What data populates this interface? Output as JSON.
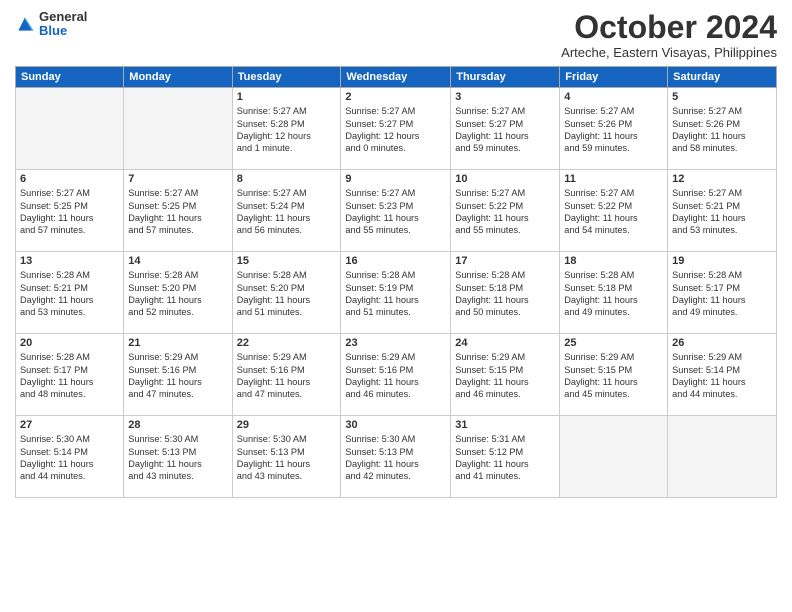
{
  "logo": {
    "general": "General",
    "blue": "Blue"
  },
  "title": "October 2024",
  "subtitle": "Arteche, Eastern Visayas, Philippines",
  "days_of_week": [
    "Sunday",
    "Monday",
    "Tuesday",
    "Wednesday",
    "Thursday",
    "Friday",
    "Saturday"
  ],
  "weeks": [
    [
      {
        "day": "",
        "info": ""
      },
      {
        "day": "",
        "info": ""
      },
      {
        "day": "1",
        "info": "Sunrise: 5:27 AM\nSunset: 5:28 PM\nDaylight: 12 hours\nand 1 minute."
      },
      {
        "day": "2",
        "info": "Sunrise: 5:27 AM\nSunset: 5:27 PM\nDaylight: 12 hours\nand 0 minutes."
      },
      {
        "day": "3",
        "info": "Sunrise: 5:27 AM\nSunset: 5:27 PM\nDaylight: 11 hours\nand 59 minutes."
      },
      {
        "day": "4",
        "info": "Sunrise: 5:27 AM\nSunset: 5:26 PM\nDaylight: 11 hours\nand 59 minutes."
      },
      {
        "day": "5",
        "info": "Sunrise: 5:27 AM\nSunset: 5:26 PM\nDaylight: 11 hours\nand 58 minutes."
      }
    ],
    [
      {
        "day": "6",
        "info": "Sunrise: 5:27 AM\nSunset: 5:25 PM\nDaylight: 11 hours\nand 57 minutes."
      },
      {
        "day": "7",
        "info": "Sunrise: 5:27 AM\nSunset: 5:25 PM\nDaylight: 11 hours\nand 57 minutes."
      },
      {
        "day": "8",
        "info": "Sunrise: 5:27 AM\nSunset: 5:24 PM\nDaylight: 11 hours\nand 56 minutes."
      },
      {
        "day": "9",
        "info": "Sunrise: 5:27 AM\nSunset: 5:23 PM\nDaylight: 11 hours\nand 55 minutes."
      },
      {
        "day": "10",
        "info": "Sunrise: 5:27 AM\nSunset: 5:22 PM\nDaylight: 11 hours\nand 55 minutes."
      },
      {
        "day": "11",
        "info": "Sunrise: 5:27 AM\nSunset: 5:22 PM\nDaylight: 11 hours\nand 54 minutes."
      },
      {
        "day": "12",
        "info": "Sunrise: 5:27 AM\nSunset: 5:21 PM\nDaylight: 11 hours\nand 53 minutes."
      }
    ],
    [
      {
        "day": "13",
        "info": "Sunrise: 5:28 AM\nSunset: 5:21 PM\nDaylight: 11 hours\nand 53 minutes."
      },
      {
        "day": "14",
        "info": "Sunrise: 5:28 AM\nSunset: 5:20 PM\nDaylight: 11 hours\nand 52 minutes."
      },
      {
        "day": "15",
        "info": "Sunrise: 5:28 AM\nSunset: 5:20 PM\nDaylight: 11 hours\nand 51 minutes."
      },
      {
        "day": "16",
        "info": "Sunrise: 5:28 AM\nSunset: 5:19 PM\nDaylight: 11 hours\nand 51 minutes."
      },
      {
        "day": "17",
        "info": "Sunrise: 5:28 AM\nSunset: 5:18 PM\nDaylight: 11 hours\nand 50 minutes."
      },
      {
        "day": "18",
        "info": "Sunrise: 5:28 AM\nSunset: 5:18 PM\nDaylight: 11 hours\nand 49 minutes."
      },
      {
        "day": "19",
        "info": "Sunrise: 5:28 AM\nSunset: 5:17 PM\nDaylight: 11 hours\nand 49 minutes."
      }
    ],
    [
      {
        "day": "20",
        "info": "Sunrise: 5:28 AM\nSunset: 5:17 PM\nDaylight: 11 hours\nand 48 minutes."
      },
      {
        "day": "21",
        "info": "Sunrise: 5:29 AM\nSunset: 5:16 PM\nDaylight: 11 hours\nand 47 minutes."
      },
      {
        "day": "22",
        "info": "Sunrise: 5:29 AM\nSunset: 5:16 PM\nDaylight: 11 hours\nand 47 minutes."
      },
      {
        "day": "23",
        "info": "Sunrise: 5:29 AM\nSunset: 5:16 PM\nDaylight: 11 hours\nand 46 minutes."
      },
      {
        "day": "24",
        "info": "Sunrise: 5:29 AM\nSunset: 5:15 PM\nDaylight: 11 hours\nand 46 minutes."
      },
      {
        "day": "25",
        "info": "Sunrise: 5:29 AM\nSunset: 5:15 PM\nDaylight: 11 hours\nand 45 minutes."
      },
      {
        "day": "26",
        "info": "Sunrise: 5:29 AM\nSunset: 5:14 PM\nDaylight: 11 hours\nand 44 minutes."
      }
    ],
    [
      {
        "day": "27",
        "info": "Sunrise: 5:30 AM\nSunset: 5:14 PM\nDaylight: 11 hours\nand 44 minutes."
      },
      {
        "day": "28",
        "info": "Sunrise: 5:30 AM\nSunset: 5:13 PM\nDaylight: 11 hours\nand 43 minutes."
      },
      {
        "day": "29",
        "info": "Sunrise: 5:30 AM\nSunset: 5:13 PM\nDaylight: 11 hours\nand 43 minutes."
      },
      {
        "day": "30",
        "info": "Sunrise: 5:30 AM\nSunset: 5:13 PM\nDaylight: 11 hours\nand 42 minutes."
      },
      {
        "day": "31",
        "info": "Sunrise: 5:31 AM\nSunset: 5:12 PM\nDaylight: 11 hours\nand 41 minutes."
      },
      {
        "day": "",
        "info": ""
      },
      {
        "day": "",
        "info": ""
      }
    ]
  ]
}
